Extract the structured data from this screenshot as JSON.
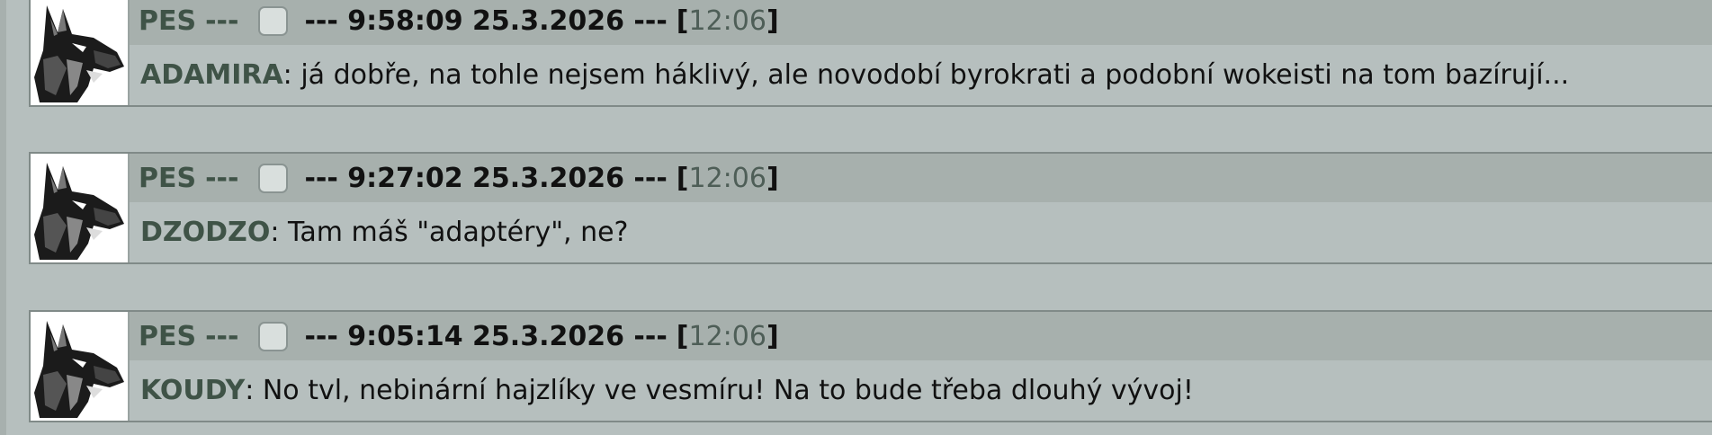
{
  "posts": [
    {
      "nick": "PES",
      "sep": "---",
      "stamp": "--- 9:58:09 25.3.2026 ---",
      "reply_time": "12:06",
      "author": "ADAMIRA",
      "message": ": já dobře, na tohle nejsem háklivý, ale novodobí byrokrati a podobní wokeisti na tom bazírují..."
    },
    {
      "nick": "PES",
      "sep": "---",
      "stamp": "--- 9:27:02 25.3.2026 ---",
      "reply_time": "12:06",
      "author": "DZODZO",
      "message": ": Tam máš \"adaptéry\", ne?"
    },
    {
      "nick": "PES",
      "sep": "---",
      "stamp": "--- 9:05:14 25.3.2026 ---",
      "reply_time": "12:06",
      "author": "KOUDY",
      "message": ": No tvl, nebinární hajzlíky ve vesmíru! Na to bude třeba dlouhý vývoj!"
    }
  ],
  "ui": {
    "avatar_icon": "german-shepherd-dog-icon",
    "checkbox_icon": "checkbox-icon",
    "bracket_open": "[",
    "bracket_close": "]"
  }
}
